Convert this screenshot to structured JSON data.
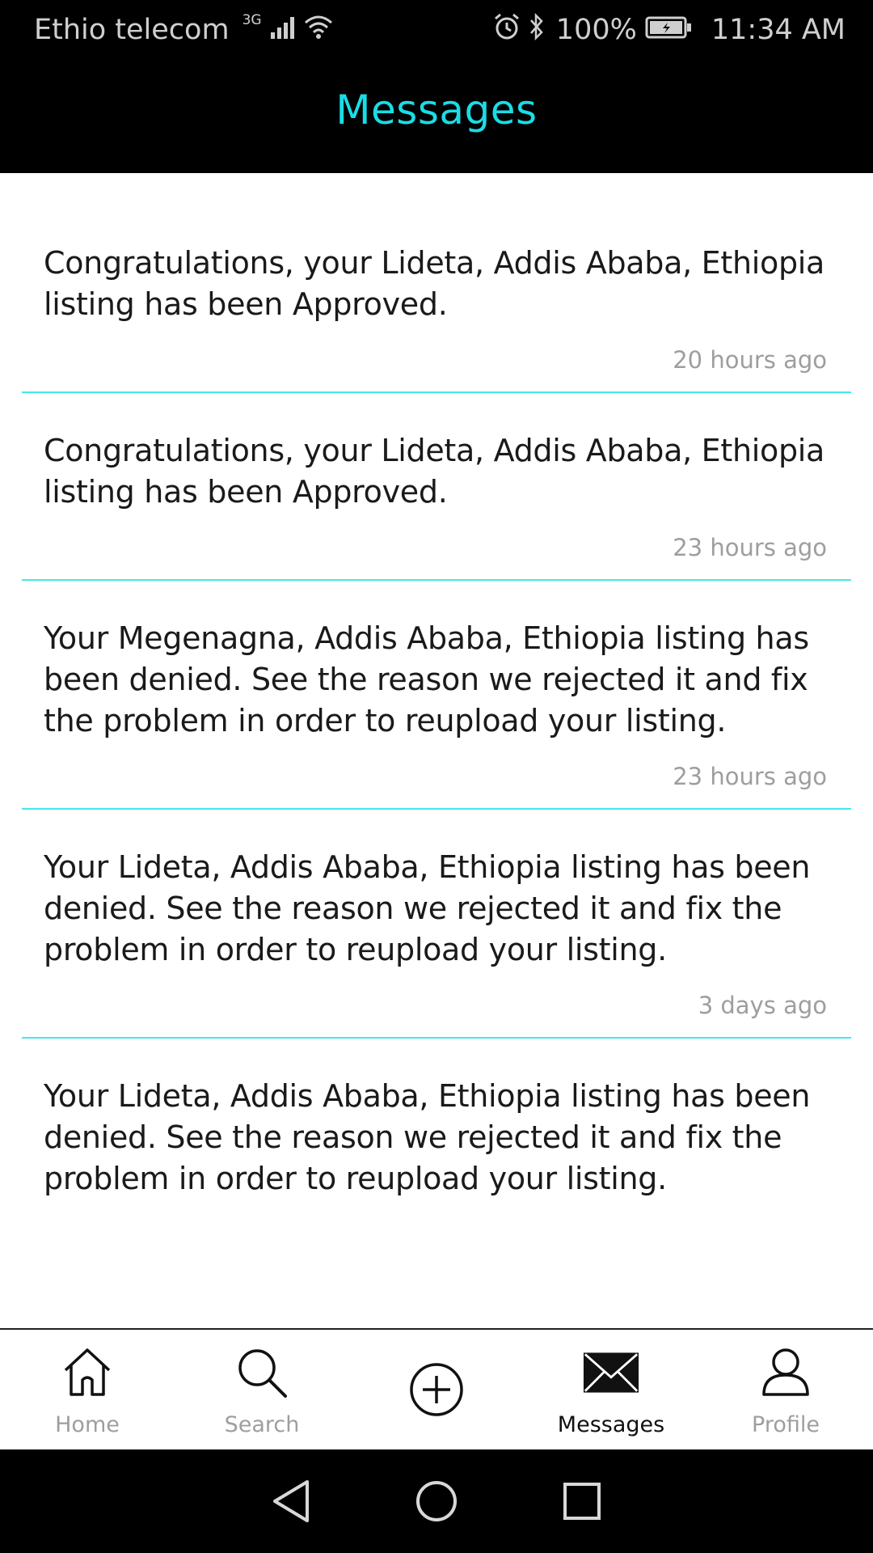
{
  "status_bar": {
    "carrier": "Ethio telecom",
    "network_type": "3G",
    "battery": "100%",
    "time": "11:34 AM"
  },
  "header": {
    "title": "Messages"
  },
  "messages": [
    {
      "text": "Congratulations, your Lideta, Addis Ababa, Ethiopia listing has been Approved.",
      "time": "20 hours ago"
    },
    {
      "text": "Congratulations, your Lideta, Addis Ababa, Ethiopia listing has been Approved.",
      "time": "23 hours ago"
    },
    {
      "text": "Your Megenagna, Addis Ababa, Ethiopia listing has been denied. See the reason we rejected it and fix the problem in order to reupload your listing.",
      "time": "23 hours ago"
    },
    {
      "text": "Your Lideta, Addis Ababa, Ethiopia listing has been denied. See the reason we rejected it and fix the problem in order to reupload your listing.",
      "time": "3 days ago"
    },
    {
      "text": "Your Lideta, Addis Ababa, Ethiopia listing has been denied. See the reason we rejected it and fix the problem in order to reupload your listing."
    }
  ],
  "bottom_nav": {
    "items": [
      {
        "label": "Home",
        "icon": "home-icon",
        "active": false
      },
      {
        "label": "Search",
        "icon": "search-icon",
        "active": false
      },
      {
        "label": "",
        "icon": "add-circle-icon",
        "active": false
      },
      {
        "label": "Messages",
        "icon": "envelope-icon",
        "active": true
      },
      {
        "label": "Profile",
        "icon": "user-icon",
        "active": false
      }
    ]
  },
  "colors": {
    "accent": "#19dde6",
    "divider": "#45e7ec",
    "muted_text": "#9e9e9e"
  }
}
